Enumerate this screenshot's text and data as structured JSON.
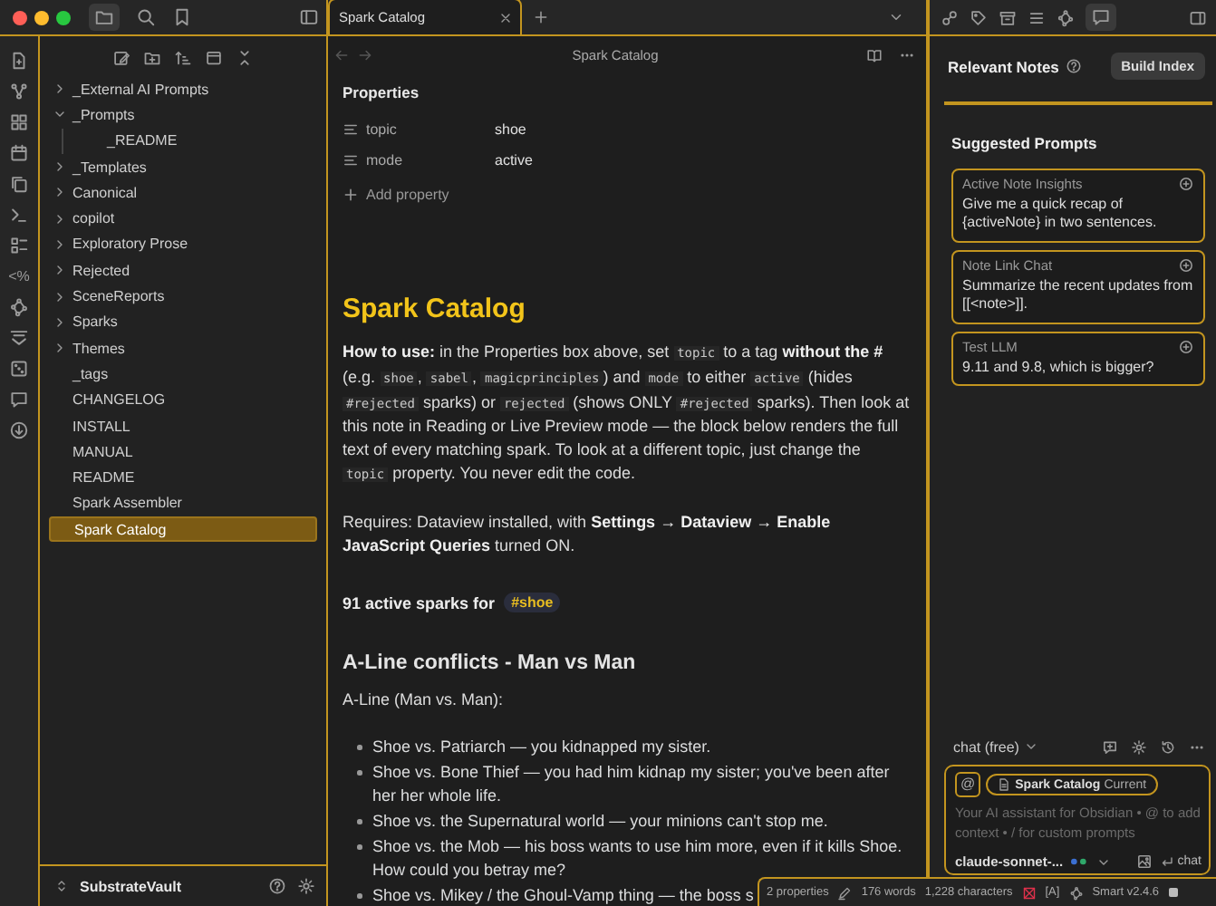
{
  "vault": {
    "name": "SubstrateVault"
  },
  "ribbon": {
    "template_glyph": "<%"
  },
  "file_tree": [
    {
      "kind": "folder",
      "label": "_External AI Prompts",
      "expanded": false,
      "selected": false
    },
    {
      "kind": "folder",
      "label": "_Prompts",
      "expanded": true,
      "selected": false,
      "children": [
        {
          "kind": "file",
          "label": "_README",
          "selected": false
        }
      ]
    },
    {
      "kind": "folder",
      "label": "_Templates",
      "expanded": false,
      "selected": false
    },
    {
      "kind": "folder",
      "label": "Canonical",
      "expanded": false,
      "selected": false
    },
    {
      "kind": "folder",
      "label": "copilot",
      "expanded": false,
      "selected": false
    },
    {
      "kind": "folder",
      "label": "Exploratory Prose",
      "expanded": false,
      "selected": false
    },
    {
      "kind": "folder",
      "label": "Rejected",
      "expanded": false,
      "selected": false
    },
    {
      "kind": "folder",
      "label": "SceneReports",
      "expanded": false,
      "selected": false
    },
    {
      "kind": "folder",
      "label": "Sparks",
      "expanded": false,
      "selected": false
    },
    {
      "kind": "folder",
      "label": "Themes",
      "expanded": false,
      "selected": false
    },
    {
      "kind": "file",
      "label": "_tags",
      "selected": false
    },
    {
      "kind": "file",
      "label": "CHANGELOG",
      "selected": false
    },
    {
      "kind": "file",
      "label": "INSTALL",
      "selected": false
    },
    {
      "kind": "file",
      "label": "MANUAL",
      "selected": false
    },
    {
      "kind": "file",
      "label": "README",
      "selected": false
    },
    {
      "kind": "file",
      "label": "Spark Assembler",
      "selected": false
    },
    {
      "kind": "file",
      "label": "Spark Catalog",
      "selected": true
    }
  ],
  "tabs": [
    {
      "label": "Spark Catalog",
      "selected": true
    }
  ],
  "view_header": {
    "title": "Spark Catalog"
  },
  "properties": {
    "heading": "Properties",
    "items": [
      {
        "key": "topic",
        "value": "shoe"
      },
      {
        "key": "mode",
        "value": "active"
      }
    ],
    "add_label": "Add property"
  },
  "document": {
    "title": "Spark Catalog",
    "intro": [
      {
        "kind": "bold",
        "text": "How to use:"
      },
      {
        "kind": "text",
        "text": " in the Properties box above, set "
      },
      {
        "kind": "code",
        "text": "topic"
      },
      {
        "kind": "text",
        "text": " to a tag "
      },
      {
        "kind": "bold",
        "text": "without the #"
      },
      {
        "kind": "text",
        "text": " (e.g. "
      },
      {
        "kind": "code",
        "text": "shoe"
      },
      {
        "kind": "text",
        "text": ", "
      },
      {
        "kind": "code",
        "text": "sabel"
      },
      {
        "kind": "text",
        "text": ", "
      },
      {
        "kind": "code",
        "text": "magicprinciples"
      },
      {
        "kind": "text",
        "text": ") and "
      },
      {
        "kind": "code",
        "text": "mode"
      },
      {
        "kind": "text",
        "text": " to either "
      },
      {
        "kind": "code",
        "text": "active"
      },
      {
        "kind": "text",
        "text": " (hides "
      },
      {
        "kind": "code",
        "text": "#rejected"
      },
      {
        "kind": "text",
        "text": " sparks) or "
      },
      {
        "kind": "code",
        "text": "rejected"
      },
      {
        "kind": "text",
        "text": " (shows ONLY "
      },
      {
        "kind": "code",
        "text": "#rejected"
      },
      {
        "kind": "text",
        "text": " sparks). Then look at this note in Reading or Live Preview mode — the block below renders the full text of every matching spark. To look at a different topic, just change the "
      },
      {
        "kind": "code",
        "text": "topic"
      },
      {
        "kind": "text",
        "text": " property. You never edit the code."
      }
    ],
    "requires": [
      {
        "kind": "text",
        "text": "Requires: Dataview installed, with "
      },
      {
        "kind": "bold",
        "text": "Settings → Dataview → Enable JavaScript Queries"
      },
      {
        "kind": "text",
        "text": " turned ON."
      }
    ],
    "count_text": "91 active sparks for",
    "count_tag": "#shoe",
    "section_heading": "A-Line conflicts - Man vs Man",
    "section_intro": "A-Line (Man vs. Man):",
    "bullets": [
      "Shoe vs. Patriarch — you kidnapped my sister.",
      "Shoe vs. Bone Thief — you had him kidnap my sister; you've been after her her whole life.",
      "Shoe vs. the Supernatural world — your minions can't stop me.",
      "Shoe vs. the Mob — his boss wants to use him more, even if it kills Shoe. How could you betray me?",
      "Shoe vs. Mikey / the Ghoul-Vamp thing — the boss s"
    ]
  },
  "right_panel": {
    "title": "Relevant Notes",
    "build_button": "Build Index",
    "prompts_heading": "Suggested Prompts",
    "prompts": [
      {
        "title": "Active Note Insights",
        "text": "Give me a quick recap of {activeNote} in two sentences."
      },
      {
        "title": "Note Link Chat",
        "text": "Summarize the recent updates from [[<note>]]."
      },
      {
        "title": "Test LLM",
        "text": "9.11 and 9.8, which is bigger?"
      }
    ],
    "chat_mode": "chat (free)",
    "mention_glyph": "@",
    "context_chip": {
      "name": "Spark Catalog",
      "tag": "Current"
    },
    "input_placeholder": "Your AI assistant for Obsidian • @ to add context • / for custom prompts",
    "model": "claude-sonnet-...",
    "send_label": "chat"
  },
  "status_bar": {
    "properties": "2 properties",
    "words": "176 words",
    "characters": "1,228 characters",
    "mode": "[A]",
    "plugin": "Smart v2.4.6"
  }
}
